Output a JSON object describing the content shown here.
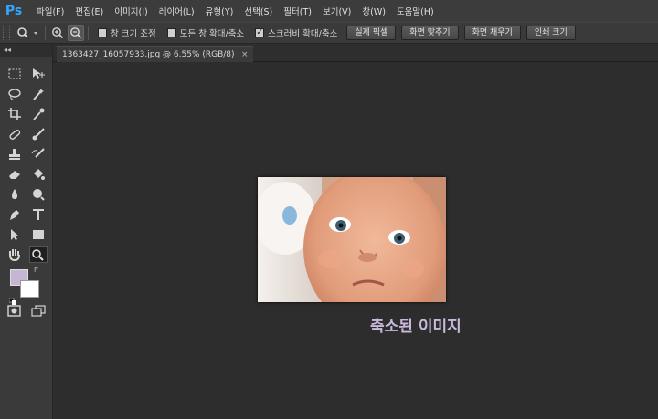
{
  "app": {
    "logo": "Ps"
  },
  "menu": {
    "items": [
      "파일(F)",
      "편집(E)",
      "이미지(I)",
      "레이어(L)",
      "유형(Y)",
      "선택(S)",
      "필터(T)",
      "보기(V)",
      "창(W)",
      "도움말(H)"
    ]
  },
  "options": {
    "resize_windows": "창 크기 조정",
    "zoom_all_windows": "모든 창 확대/축소",
    "scrubby_zoom": "스크러비 확대/축소",
    "btn_actual": "실제 픽셀",
    "btn_fit": "화면 맞추기",
    "btn_fill": "화면 채우기",
    "btn_print": "인쇄 크기"
  },
  "document": {
    "tab_title": "1363427_16057933.jpg @ 6.55% (RGB/8)",
    "close": "×"
  },
  "caption": "축소된 이미지",
  "colors": {
    "foreground": "#c7b5d4",
    "background": "#ffffff",
    "caption": "#c9b9dc"
  },
  "toolbar_icons": [
    "marquee-icon",
    "move-icon",
    "lasso-icon",
    "magic-wand-icon",
    "crop-icon",
    "eyedropper-icon",
    "healing-brush-icon",
    "brush-icon",
    "clone-stamp-icon",
    "history-brush-icon",
    "eraser-icon",
    "paint-bucket-icon",
    "blur-icon",
    "dodge-icon",
    "pen-icon",
    "type-icon",
    "path-select-icon",
    "rectangle-icon",
    "hand-icon",
    "zoom-icon",
    "quick-mask-icon",
    "screen-mode-icon"
  ]
}
